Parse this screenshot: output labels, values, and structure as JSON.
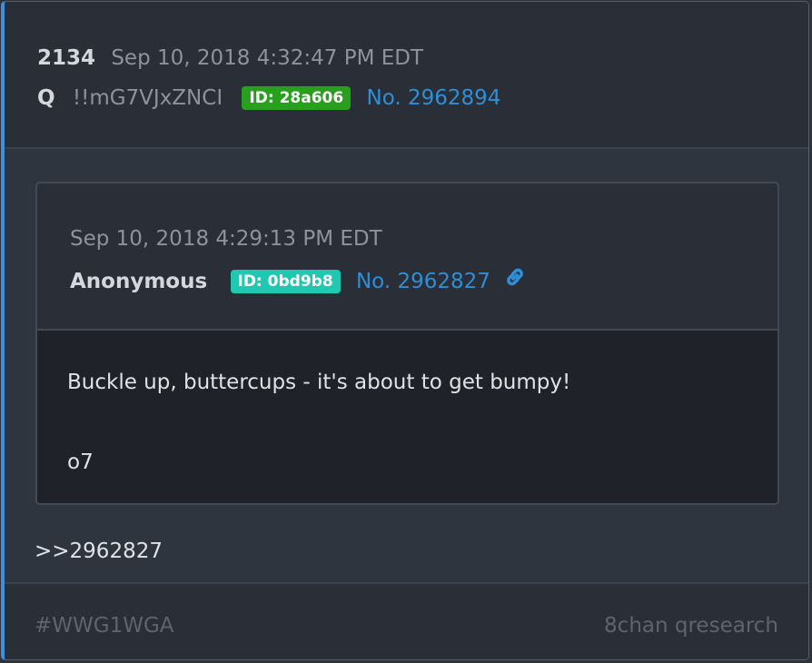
{
  "post": {
    "number": "2134",
    "date": "Sep 10, 2018 4:32:47 PM EDT",
    "author": "Q",
    "tripcode": "!!mG7VJxZNCI",
    "id_badge": "ID: 28a606",
    "post_link": "No. 2962894",
    "reply_ref": ">>2962827"
  },
  "quoted": {
    "date": "Sep 10, 2018 4:29:13 PM EDT",
    "author": "Anonymous",
    "id_badge": "ID: 0bd9b8",
    "post_link": "No. 2962827",
    "link_icon": "link-icon",
    "body_line1": "Buckle up, buttercups - it's about to get bumpy!",
    "body_line2": "o7"
  },
  "footer": {
    "hashtag": "#WWG1WGA",
    "source": "8chan qresearch"
  },
  "colors": {
    "accent_bar": "#3f8fe0",
    "id_green": "#28a01e",
    "id_teal": "#1fc8b0",
    "link": "#2e8ed6"
  }
}
